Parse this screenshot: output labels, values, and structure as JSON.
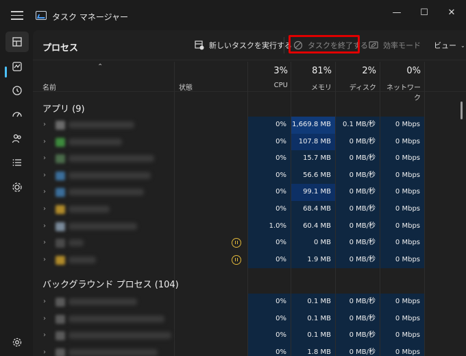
{
  "window": {
    "title": "タスク マネージャー",
    "controls": {
      "minimize": "—",
      "maximize": "☐",
      "close": "✕"
    }
  },
  "nav": {
    "items": [
      "processes-icon",
      "performance-icon",
      "app-history-icon",
      "startup-icon",
      "users-icon",
      "details-icon",
      "services-icon"
    ],
    "settings": "gear-icon",
    "accent": "#4cc2ff"
  },
  "toolbar": {
    "page_title": "プロセス",
    "run_new_task": "新しいタスクを実行する",
    "end_task": "タスクを終了する",
    "efficiency_mode": "効率モード",
    "view": "ビュー"
  },
  "columns": {
    "name": "名前",
    "status": "状態",
    "cpu": {
      "pct": "3%",
      "label": "CPU"
    },
    "memory": {
      "pct": "81%",
      "label": "メモリ"
    },
    "disk": {
      "pct": "2%",
      "label": "ディスク"
    },
    "network": {
      "pct": "0%",
      "label": "ネットワーク"
    }
  },
  "groups": {
    "apps": {
      "label": "アプリ (9)",
      "rows": [
        {
          "cpu": "0%",
          "mem": "1,669.8 MB",
          "disk": "0.1 MB/秒",
          "net": "0 Mbps",
          "paused": false
        },
        {
          "cpu": "0%",
          "mem": "107.8 MB",
          "disk": "0 MB/秒",
          "net": "0 Mbps",
          "paused": false
        },
        {
          "cpu": "0%",
          "mem": "15.7 MB",
          "disk": "0 MB/秒",
          "net": "0 Mbps",
          "paused": false
        },
        {
          "cpu": "0%",
          "mem": "56.6 MB",
          "disk": "0 MB/秒",
          "net": "0 Mbps",
          "paused": false
        },
        {
          "cpu": "0%",
          "mem": "99.1 MB",
          "disk": "0 MB/秒",
          "net": "0 Mbps",
          "paused": false
        },
        {
          "cpu": "0%",
          "mem": "68.4 MB",
          "disk": "0 MB/秒",
          "net": "0 Mbps",
          "paused": false
        },
        {
          "cpu": "1.0%",
          "mem": "60.4 MB",
          "disk": "0 MB/秒",
          "net": "0 Mbps",
          "paused": false
        },
        {
          "cpu": "0%",
          "mem": "0 MB",
          "disk": "0 MB/秒",
          "net": "0 Mbps",
          "paused": true
        },
        {
          "cpu": "0%",
          "mem": "1.9 MB",
          "disk": "0 MB/秒",
          "net": "0 Mbps",
          "paused": true
        }
      ]
    },
    "background": {
      "label": "バックグラウンド プロセス (104)",
      "rows": [
        {
          "cpu": "0%",
          "mem": "0.1 MB",
          "disk": "0 MB/秒",
          "net": "0 Mbps"
        },
        {
          "cpu": "0%",
          "mem": "0.1 MB",
          "disk": "0 MB/秒",
          "net": "0 Mbps"
        },
        {
          "cpu": "0%",
          "mem": "0.1 MB",
          "disk": "0 MB/秒",
          "net": "0 Mbps"
        },
        {
          "cpu": "0%",
          "mem": "1.8 MB",
          "disk": "0 MB/秒",
          "net": "0 Mbps"
        }
      ]
    }
  }
}
